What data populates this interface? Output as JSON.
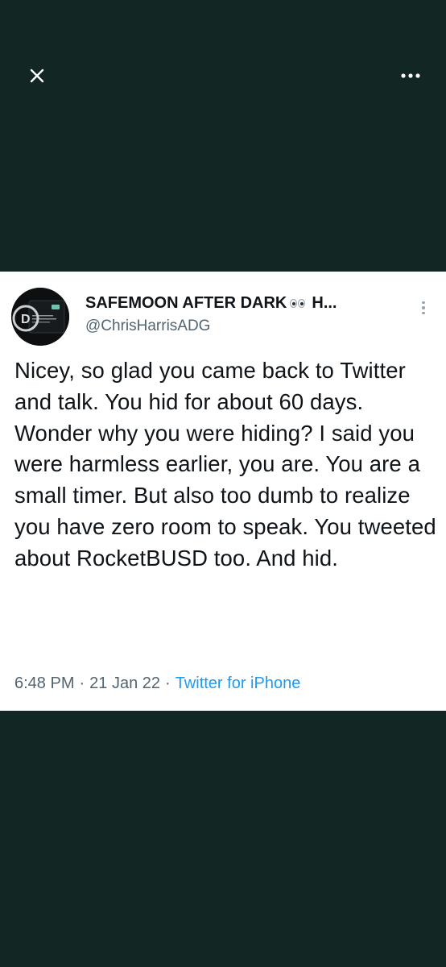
{
  "top_bar": {
    "close_icon": "close-icon",
    "more_icon": "more-horizontal-icon"
  },
  "tweet": {
    "display_name": "SAFEMOON AFTER DARK",
    "display_name_suffix": "H...",
    "name_emoji": "eyes-emoji",
    "handle": "@ChrisHarrisADG",
    "avatar_caption": "SAFEMOON AFTER DARK",
    "text": "Nicey, so glad you came back to Twitter and talk. You hid for about 60 days. Wonder why you were hiding? I said you were harmless earlier, you are. You are a small timer. But also too dumb to realize you have zero room to speak. You tweeted about RocketBUSD too. And hid.",
    "time": "6:48 PM",
    "date": "21 Jan 22",
    "source": "Twitter for iPhone",
    "separator": "·"
  },
  "colors": {
    "background": "#122623",
    "card": "#ffffff",
    "text": "#0f1419",
    "secondary": "#536471",
    "link": "#1d9bf0"
  }
}
